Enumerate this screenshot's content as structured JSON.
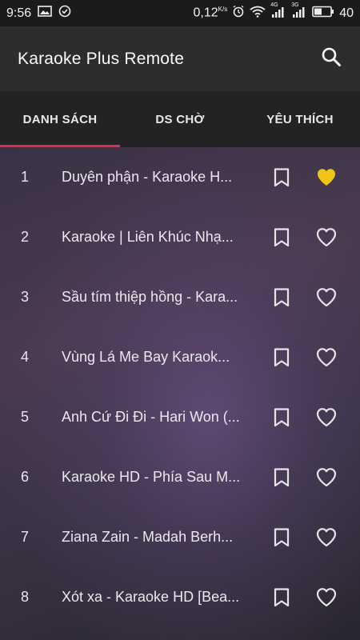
{
  "status_bar": {
    "time": "9:56",
    "speed": "0,12",
    "speed_unit": "K/s",
    "network_a": "4G",
    "network_b": "3G",
    "battery": "40"
  },
  "app_bar": {
    "title": "Karaoke Plus Remote",
    "search_icon": "search-icon"
  },
  "tabs": [
    {
      "label": "DANH SÁCH",
      "active": true
    },
    {
      "label": "DS CHỜ",
      "active": false
    },
    {
      "label": "YÊU THÍCH",
      "active": false
    }
  ],
  "colors": {
    "accent": "#e2284f",
    "favorite": "#f2c418",
    "icon": "#e6e6e6"
  },
  "songs": [
    {
      "num": "1",
      "title": "Duyên phận - Karaoke H...",
      "favorite": true
    },
    {
      "num": "2",
      "title": "Karaoke | Liên Khúc Nhạ...",
      "favorite": false
    },
    {
      "num": "3",
      "title": "Sầu tím thiệp hồng - Kara...",
      "favorite": false
    },
    {
      "num": "4",
      "title": "Vùng Lá Me Bay   Karaok...",
      "favorite": false
    },
    {
      "num": "5",
      "title": "Anh Cứ Đi Đi - Hari Won (...",
      "favorite": false
    },
    {
      "num": "6",
      "title": "Karaoke HD - Phía Sau M...",
      "favorite": false
    },
    {
      "num": "7",
      "title": "Ziana Zain - Madah Berh...",
      "favorite": false
    },
    {
      "num": "8",
      "title": "Xót xa - Karaoke HD [Bea...",
      "favorite": false
    }
  ]
}
